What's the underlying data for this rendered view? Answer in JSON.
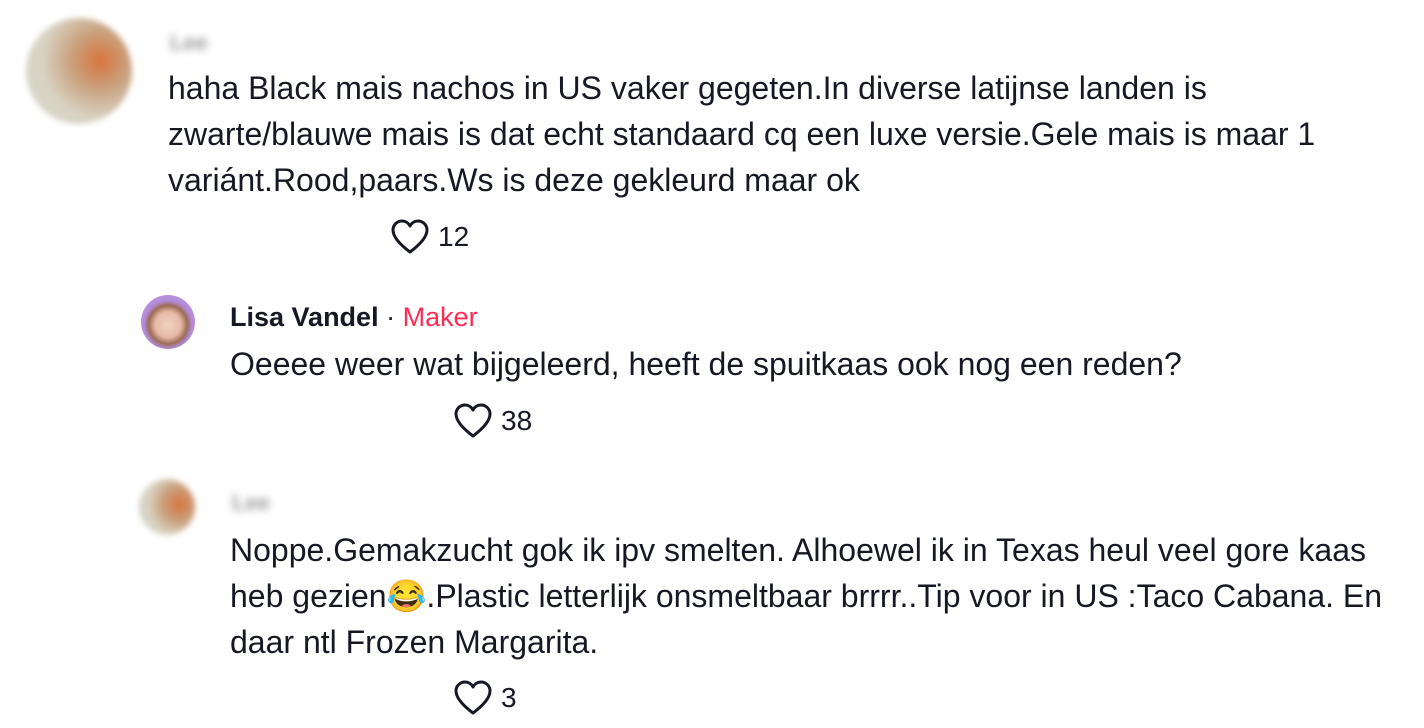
{
  "comments": [
    {
      "username": "Lee",
      "text": "haha Black mais nachos in US vaker gegeten.In diverse latijnse landen is zwarte/blauwe mais is dat echt standaard cq een luxe versie.Gele mais is maar 1 variánt.Rood,paars.Ws is deze gekleurd maar ok",
      "likes": "12"
    },
    {
      "username": "Lisa Vandel",
      "separator": " · ",
      "badge": "Maker",
      "text": "Oeeee weer wat bijgeleerd, heeft de spuitkaas ook nog een reden?",
      "likes": "38"
    },
    {
      "username": "Lee",
      "text": "Noppe.Gemakzucht gok ik ipv smelten. Alhoewel ik in Texas heul veel gore kaas heb gezien😂.Plastic letterlijk onsmeltbaar brrrr..Tip voor in US :Taco Cabana. En daar ntl Frozen Margarita.",
      "likes": "3"
    }
  ],
  "colors": {
    "text": "#161823",
    "maker_accent": "#fe2c55",
    "icon_stroke": "#161823"
  },
  "icons": {
    "like": "heart-outline-icon"
  }
}
